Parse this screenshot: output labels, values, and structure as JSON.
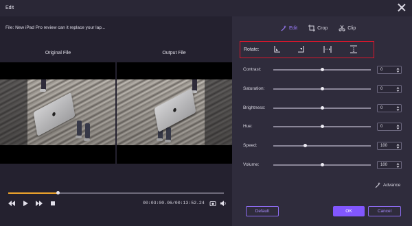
{
  "window": {
    "title": "Edit"
  },
  "player": {
    "file_label": "File: New iPad Pro review can it replace your lap...",
    "original_label": "Original File",
    "output_label": "Output File",
    "progress": 0.23,
    "timecode": "00:03:00.06/00:13:52.24"
  },
  "tabs": [
    {
      "label": "Edit",
      "active": true
    },
    {
      "label": "Crop",
      "active": false
    },
    {
      "label": "Clip",
      "active": false
    }
  ],
  "rotate": {
    "label": "Rotate:"
  },
  "adjustments": [
    {
      "label": "Contrast:",
      "value": "0",
      "level": 0.5
    },
    {
      "label": "Saturation:",
      "value": "0",
      "level": 0.5
    },
    {
      "label": "Brightness:",
      "value": "0",
      "level": 0.5
    },
    {
      "label": "Hue:",
      "value": "0",
      "level": 0.5
    },
    {
      "label": "Speed:",
      "value": "100",
      "level": 0.33
    },
    {
      "label": "Volume:",
      "value": "100",
      "level": 0.5
    }
  ],
  "advance_label": "Advance",
  "buttons": {
    "default": "Default",
    "ok": "OK",
    "cancel": "Cancel"
  },
  "colors": {
    "accent": "#8257ff",
    "highlight_box": "#e0162b",
    "progress": "#f0a52c"
  }
}
